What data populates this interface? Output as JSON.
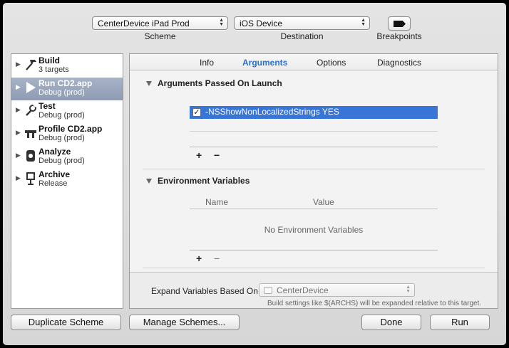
{
  "toolbar": {
    "scheme_value": "CenterDevice iPad Prod",
    "scheme_label": "Scheme",
    "destination_value": "iOS Device",
    "destination_label": "Destination",
    "breakpoints_label": "Breakpoints"
  },
  "sidebar": {
    "items": [
      {
        "title": "Build",
        "subtitle": "3 targets",
        "icon": "hammer-icon",
        "selected": false
      },
      {
        "title": "Run CD2.app",
        "subtitle": "Debug (prod)",
        "icon": "play-icon",
        "selected": true
      },
      {
        "title": "Test",
        "subtitle": "Debug (prod)",
        "icon": "wrench-icon",
        "selected": false
      },
      {
        "title": "Profile CD2.app",
        "subtitle": "Debug (prod)",
        "icon": "profile-tool-icon",
        "selected": false
      },
      {
        "title": "Analyze",
        "subtitle": "Debug (prod)",
        "icon": "analyze-icon",
        "selected": false
      },
      {
        "title": "Archive",
        "subtitle": "Release",
        "icon": "archive-icon",
        "selected": false
      }
    ]
  },
  "main": {
    "tabs": [
      {
        "label": "Info",
        "active": false
      },
      {
        "label": "Arguments",
        "active": true
      },
      {
        "label": "Options",
        "active": false
      },
      {
        "label": "Diagnostics",
        "active": false
      }
    ],
    "arguments": {
      "title": "Arguments Passed On Launch",
      "items": [
        {
          "checked": true,
          "value": "-NSShowNonLocalizedStrings YES"
        }
      ],
      "add_label": "+",
      "remove_label": "−"
    },
    "environment": {
      "title": "Environment Variables",
      "columns": [
        "Name",
        "Value"
      ],
      "empty_message": "No Environment Variables",
      "add_label": "+",
      "remove_label": "−"
    },
    "expand": {
      "label": "Expand Variables Based On",
      "selected": "CenterDevice",
      "hint": "Build settings like $(ARCHS) will be expanded relative to this target."
    }
  },
  "footer": {
    "duplicate_label": "Duplicate Scheme",
    "manage_label": "Manage Schemes...",
    "done_label": "Done",
    "run_label": "Run"
  },
  "colors": {
    "selection_blue": "#3875d7",
    "active_tab": "#2a6fc9",
    "sidebar_selected": "#8e9bb3"
  }
}
